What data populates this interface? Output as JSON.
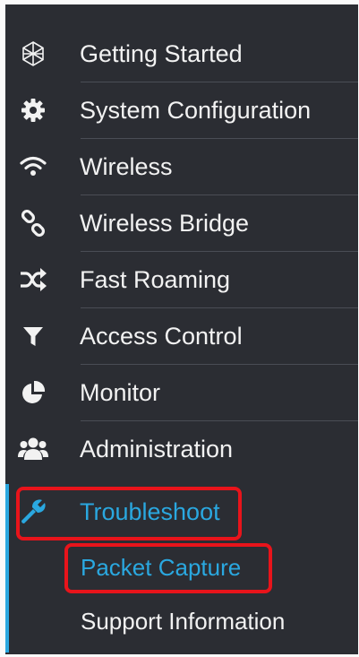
{
  "nav": {
    "items": [
      {
        "label": "Getting Started",
        "icon": "network-globe-icon"
      },
      {
        "label": "System Configuration",
        "icon": "gear-icon"
      },
      {
        "label": "Wireless",
        "icon": "wifi-icon"
      },
      {
        "label": "Wireless Bridge",
        "icon": "bridge-link-icon"
      },
      {
        "label": "Fast Roaming",
        "icon": "shuffle-icon"
      },
      {
        "label": "Access Control",
        "icon": "filter-icon"
      },
      {
        "label": "Monitor",
        "icon": "pie-chart-icon"
      },
      {
        "label": "Administration",
        "icon": "users-icon"
      },
      {
        "label": "Troubleshoot",
        "icon": "wrench-icon",
        "active": true
      }
    ],
    "subitems": [
      {
        "label": "Packet Capture",
        "active": true
      },
      {
        "label": "Support Information"
      }
    ]
  },
  "colors": {
    "background": "#2b2d33",
    "text": "#f2f2f2",
    "active": "#2aa8e0",
    "highlight": "#e8141b"
  }
}
